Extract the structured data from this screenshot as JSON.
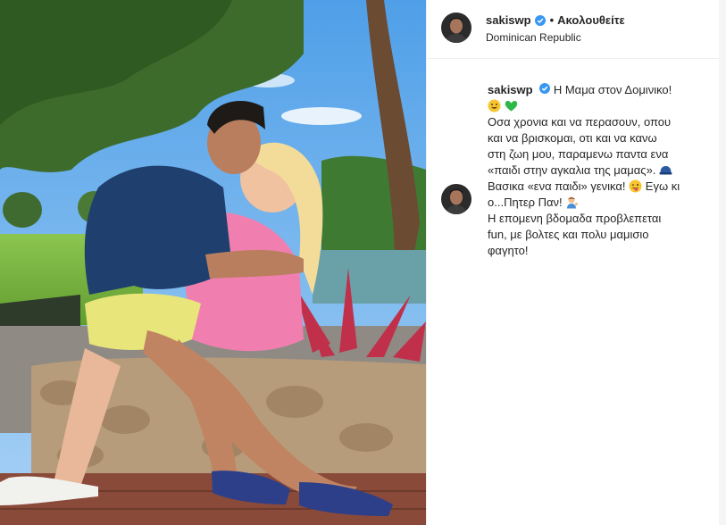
{
  "post": {
    "username": "sakiswp",
    "follow_label": "Ακολουθείτε",
    "location": "Dominican Republic",
    "colors": {
      "verified": "#3897f0",
      "text": "#262626",
      "divider": "#efefef"
    },
    "caption": {
      "first_line": "Η Μαμα στον Δομινικο!",
      "lines": [
        "Οσα χρονια και να περασουν, οπου",
        "και να βρισκομαι, οτι και να κανω",
        "στη ζωη μου, παραμενω παντα ενα",
        "«παιδι στην αγκαλια της μαμας».",
        "Βασικα «ενα παιδι» γενικα!",
        "Εγω κι",
        "ο...Πητερ Παν!",
        "Η επομενη βδομαδα προβλεπεται",
        "fun, με βολτες και πολυ μαμισιο",
        "φαγητο!"
      ],
      "emoji_icons": [
        "grinning-face-icon",
        "green-heart-icon",
        "blue-cap-icon",
        "winking-tongue-face-icon",
        "person-tipping-hand-icon"
      ]
    }
  }
}
